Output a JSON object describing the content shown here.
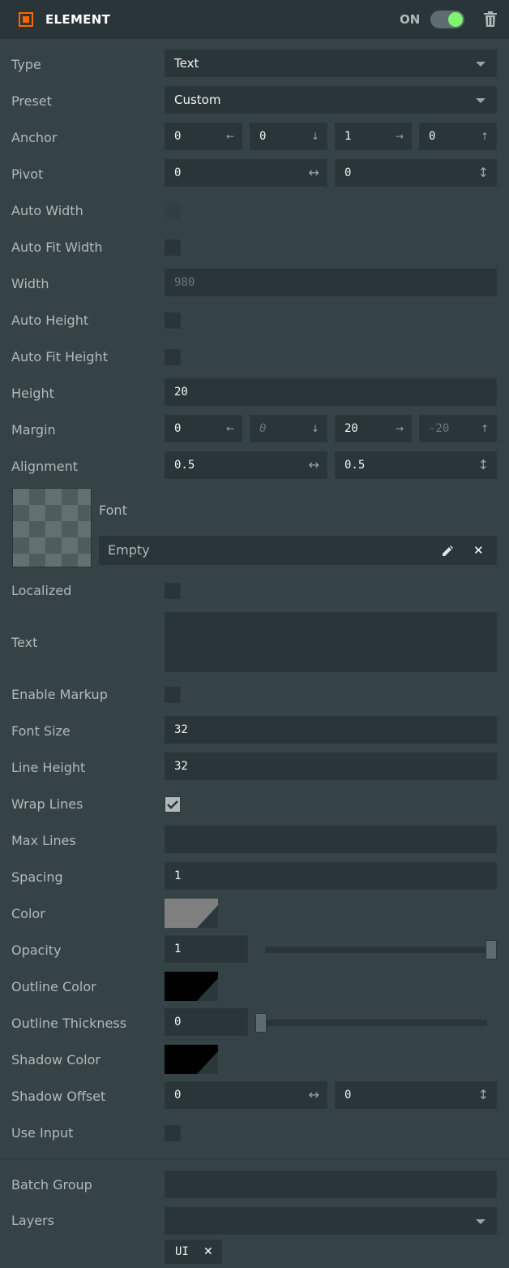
{
  "header": {
    "title": "ELEMENT",
    "toggle_label": "ON",
    "toggle_on": true,
    "accent": "#ff6600",
    "toggle_color": "#7ff26e"
  },
  "labels": {
    "type": "Type",
    "preset": "Preset",
    "anchor": "Anchor",
    "pivot": "Pivot",
    "auto_width": "Auto Width",
    "auto_fit_width": "Auto Fit Width",
    "width": "Width",
    "auto_height": "Auto Height",
    "auto_fit_height": "Auto Fit Height",
    "height": "Height",
    "margin": "Margin",
    "alignment": "Alignment",
    "font": "Font",
    "localized": "Localized",
    "text": "Text",
    "enable_markup": "Enable Markup",
    "font_size": "Font Size",
    "line_height": "Line Height",
    "wrap_lines": "Wrap Lines",
    "max_lines": "Max Lines",
    "spacing": "Spacing",
    "color": "Color",
    "opacity": "Opacity",
    "outline_color": "Outline Color",
    "outline_thickness": "Outline Thickness",
    "shadow_color": "Shadow Color",
    "shadow_offset": "Shadow Offset",
    "use_input": "Use Input",
    "batch_group": "Batch Group",
    "layers": "Layers"
  },
  "values": {
    "type": "Text",
    "preset": "Custom",
    "anchor": [
      "0",
      "0",
      "1",
      "0"
    ],
    "pivot": [
      "0",
      "0"
    ],
    "width": "980",
    "height": "20",
    "margin": [
      "0",
      "0",
      "20",
      "-20"
    ],
    "alignment": [
      "0.5",
      "0.5"
    ],
    "font_asset": "Empty",
    "text": "",
    "font_size": "32",
    "line_height": "32",
    "max_lines": "",
    "spacing": "1",
    "opacity": "1",
    "opacity_level": 1,
    "outline_thickness": "0",
    "outline_level": 0,
    "shadow_offset": [
      "0",
      "0"
    ],
    "batch_group": "",
    "layers_chip": "UI"
  },
  "checks": {
    "auto_width": false,
    "auto_fit_width": false,
    "auto_height": false,
    "auto_fit_height": false,
    "localized": false,
    "enable_markup": false,
    "wrap_lines": true,
    "use_input": false
  },
  "colors": {
    "color": "#808080",
    "outline_color": "#000000",
    "shadow_color": "#000000"
  },
  "icons": {
    "arrow_left": "←",
    "arrow_down": "↓",
    "arrow_right": "→",
    "arrow_up": "↑",
    "horizontal": "↔",
    "vertical": "↕",
    "close": "✕"
  }
}
